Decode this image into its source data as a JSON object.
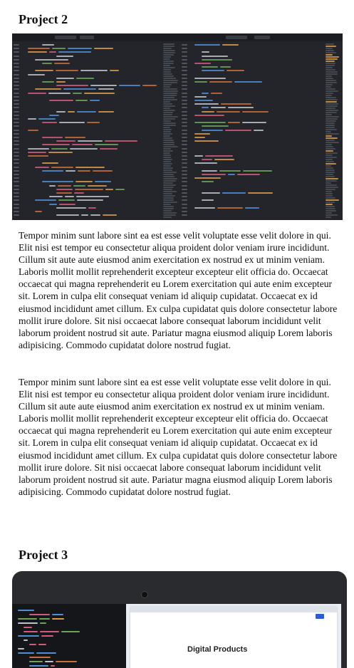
{
  "sections": [
    {
      "title": "Project 2",
      "paragraphs": [
        "Tempor minim sunt labore sint ea est esse velit voluptate esse velit dolore in qui. Elit nisi est tempor eu consectetur aliqua proident dolor veniam irure incididunt. Cillum sit aute aute eiusmod anim exercitation ex nostrud ex ut minim veniam. Laboris mollit mollit reprehenderit excepteur excepteur elit officia do. Occaecat occaecat qui magna reprehenderit eu Lorem exercitation qui aute enim excepteur sit. Lorem in culpa elit consequat veniam id aliquip cupidatat. Occaecat ex id eiusmod incididunt amet cillum. Ex culpa cupidatat quis dolore consectetur labore mollit irure dolore. Sit nisi occaecat labore consequat laborum incididunt velit laborum proident nostrud sit aute. Pariatur magna eiusmod aliquip Lorem laboris adipisicing. Commodo cupidatat dolore nostrud fugiat.",
        "Tempor minim sunt labore sint ea est esse velit voluptate esse velit dolore in qui. Elit nisi est tempor eu consectetur aliqua proident dolor veniam irure incididunt. Cillum sit aute aute eiusmod anim exercitation ex nostrud ex ut minim veniam. Laboris mollit mollit reprehenderit excepteur excepteur elit officia do. Occaecat occaecat qui magna reprehenderit eu Lorem exercitation qui aute enim excepteur sit. Lorem in culpa elit consequat veniam id aliquip cupidatat. Occaecat ex id eiusmod incididunt amet cillum. Ex culpa cupidatat quis dolore consectetur labore mollit irure dolore. Sit nisi occaecat labore consequat laborum incididunt velit laborum proident nostrud sit aute. Pariatur magna eiusmod aliquip Lorem laboris adipisicing. Commodo cupidatat dolore nostrud fugiat."
      ]
    },
    {
      "title": "Project 3",
      "photo_text": "Digital Products"
    }
  ],
  "colors": {
    "editor_bg": "#23252b",
    "code_tag": "#4f8fd6",
    "code_attr": "#d99a4a",
    "code_string": "#c86f3a",
    "code_text": "#bfc3c9",
    "code_green": "#6fa35a",
    "code_pink": "#d25a7a",
    "accent_button": "#2d5bd6"
  }
}
